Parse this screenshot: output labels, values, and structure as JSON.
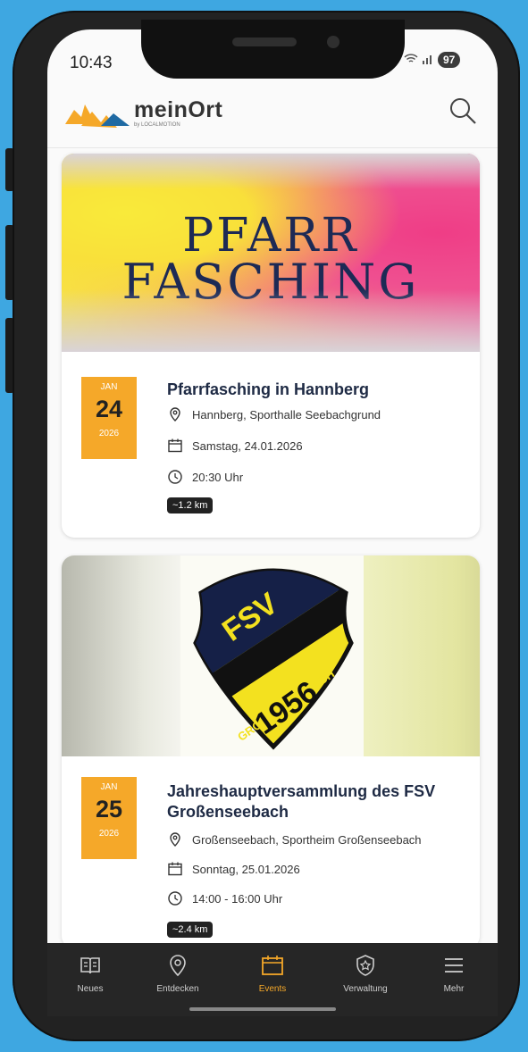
{
  "status_bar": {
    "time": "10:43",
    "battery": "97"
  },
  "header": {
    "brand": "meinOrt",
    "brand_sub": "by LOCALMOTION"
  },
  "events": [
    {
      "banner_line1": "PFARR",
      "banner_line2": "FASCHING",
      "month": "JAN",
      "day": "24",
      "year": "2026",
      "title": "Pfarrfasching in Hannberg",
      "location": "Hannberg, Sporthalle Seebachgrund",
      "date": "Samstag, 24.01.2026",
      "time": "20:30 Uhr",
      "distance": "~1.2 km"
    },
    {
      "crest_top": "FSV",
      "crest_name": "GROSSENSEEBACH",
      "crest_year": "1956",
      "month": "JAN",
      "day": "25",
      "year": "2026",
      "title": "Jahreshauptversammlung des FSV Großenseebach",
      "location": "Großenseebach, Sportheim Großenseebach",
      "date": "Sonntag, 25.01.2026",
      "time": "14:00 - 16:00 Uhr",
      "distance": "~2.4 km"
    }
  ],
  "nav": [
    {
      "label": "Neues",
      "icon": "book-icon"
    },
    {
      "label": "Entdecken",
      "icon": "map-pin-icon"
    },
    {
      "label": "Events",
      "icon": "calendar-icon",
      "active": true
    },
    {
      "label": "Verwaltung",
      "icon": "shield-icon"
    },
    {
      "label": "Mehr",
      "icon": "menu-icon"
    }
  ],
  "colors": {
    "accent": "#f5a829",
    "nav_bg": "#262626",
    "background": "#3ea7e1"
  }
}
